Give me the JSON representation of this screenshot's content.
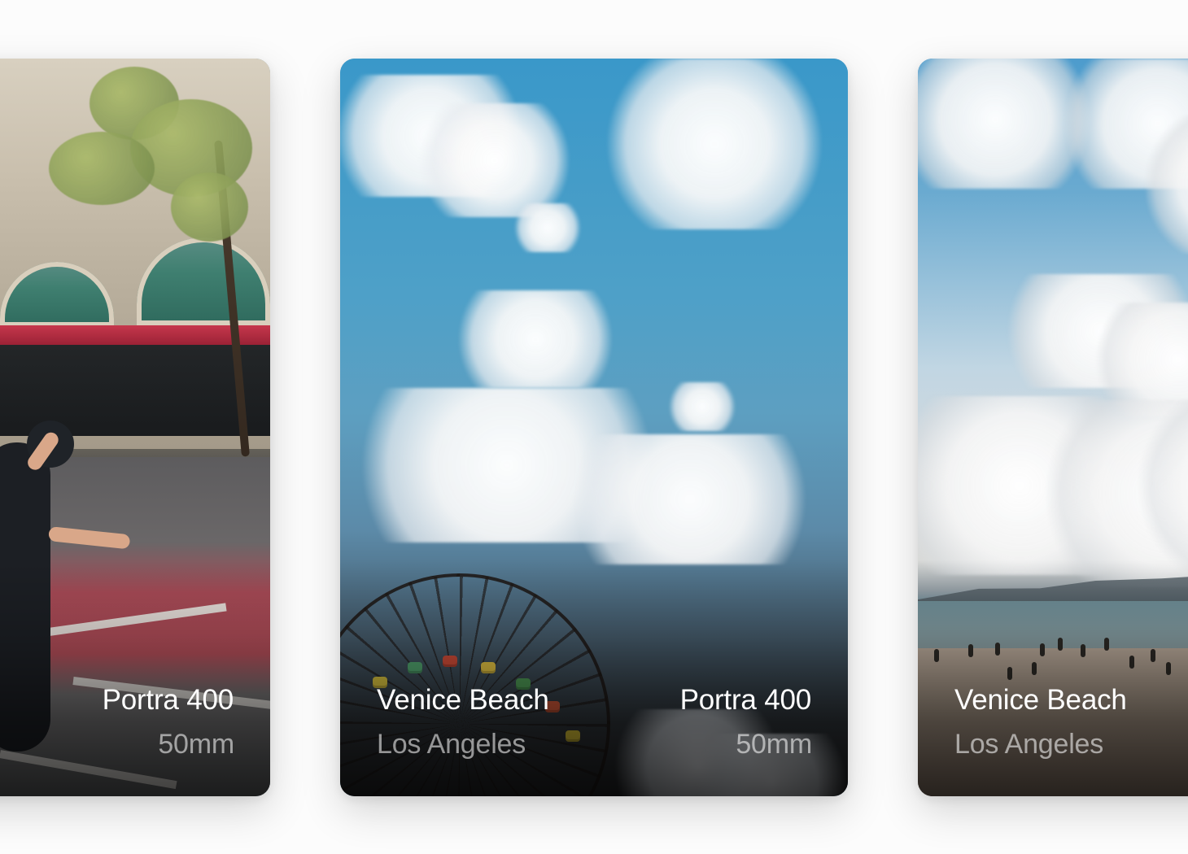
{
  "cards": [
    {
      "kind": "street",
      "right_primary": "Portra 400",
      "right_secondary": "50mm"
    },
    {
      "kind": "sky",
      "left_primary": "Venice Beach",
      "left_secondary": "Los Angeles",
      "right_primary": "Portra 400",
      "right_secondary": "50mm"
    },
    {
      "kind": "beach",
      "left_primary": "Venice Beach",
      "left_secondary": "Los Angeles"
    }
  ]
}
